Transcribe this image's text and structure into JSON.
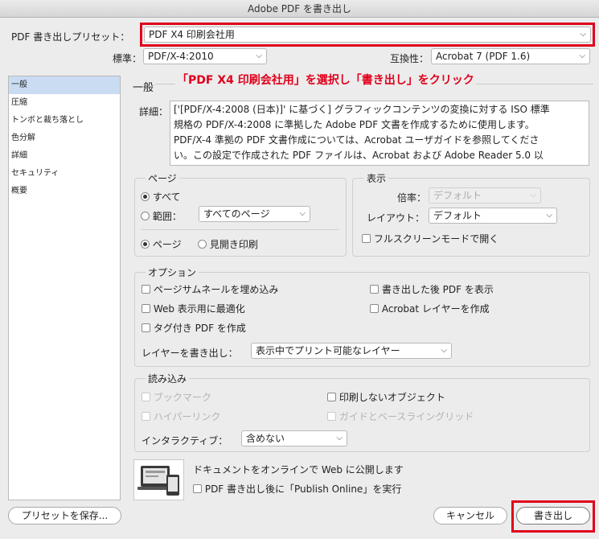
{
  "window": {
    "title": "Adobe PDF を書き出し"
  },
  "preset": {
    "label": "PDF 書き出しプリセット：",
    "value": "PDF X4 印刷会社用"
  },
  "standard": {
    "label": "標準：",
    "value": "PDF/X-4:2010"
  },
  "compat": {
    "label": "互換性：",
    "value": "Acrobat 7 (PDF 1.6)"
  },
  "sidebar": {
    "items": [
      {
        "label": "一般"
      },
      {
        "label": "圧縮"
      },
      {
        "label": "トンボと裁ち落とし"
      },
      {
        "label": "色分解"
      },
      {
        "label": "詳細"
      },
      {
        "label": "セキュリティ"
      },
      {
        "label": "概要"
      }
    ]
  },
  "main": {
    "heading": "一般",
    "annotation": "「PDF X4 印刷会社用」を選択し「書き出し」をクリック",
    "description_label": "詳細：",
    "description_lines": [
      "['[PDF/X-4:2008 (日本)]' に基づく] グラフィックコンテンツの変換に対する ISO 標準",
      "規格の PDF/X-4:2008 に準拠した Adobe PDF 文書を作成するために使用します。",
      "PDF/X-4 準拠の PDF 文書作成については、Acrobat ユーザガイドを参照してくださ",
      "い。この設定で作成された PDF ファイルは、Acrobat および Adobe Reader 5.0 以"
    ]
  },
  "pages": {
    "title": "ページ",
    "all_label": "すべて",
    "range_label": "範囲：",
    "range_value": "すべてのページ",
    "pages_label": "ページ",
    "spreads_label": "見開き印刷"
  },
  "view": {
    "title": "表示",
    "zoom_label": "倍率：",
    "zoom_value": "デフォルト",
    "layout_label": "レイアウト：",
    "layout_value": "デフォルト",
    "fullscreen_label": "フルスクリーンモードで開く"
  },
  "options": {
    "title": "オプション",
    "thumbnails": "ページサムネールを埋め込み",
    "web_optimize": "Web 表示用に最適化",
    "tagged": "タグ付き PDF を作成",
    "view_after": "書き出した後 PDF を表示",
    "acrobat_layers": "Acrobat レイヤーを作成",
    "layers_label": "レイヤーを書き出し：",
    "layers_value": "表示中でプリント可能なレイヤー"
  },
  "include": {
    "title": "読み込み",
    "bookmarks": "ブックマーク",
    "hyperlinks": "ハイパーリンク",
    "non_printing": "印刷しないオブジェクト",
    "guides": "ガイドとベースライングリッド",
    "interactive_label": "インタラクティブ：",
    "interactive_value": "含めない"
  },
  "publish": {
    "text": "ドキュメントをオンラインで Web に公開します",
    "checkbox_label": "PDF 書き出し後に「Publish Online」を実行"
  },
  "buttons": {
    "save_preset": "プリセットを保存...",
    "cancel": "キャンセル",
    "export": "書き出し"
  }
}
